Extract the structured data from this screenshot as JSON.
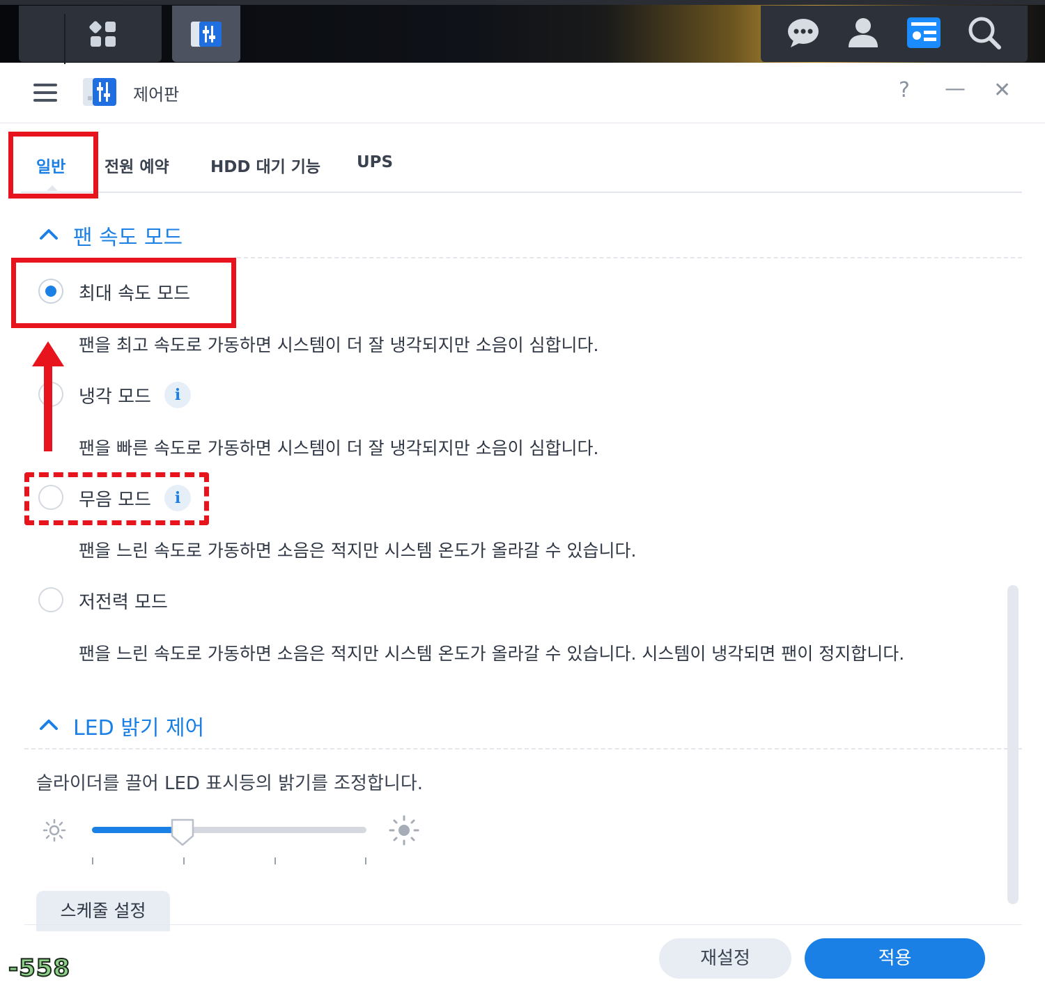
{
  "taskbar": {
    "left_icons": [
      "main-menu-icon",
      "control-panel-app-icon"
    ],
    "right_icons": [
      "chat-icon",
      "user-icon",
      "widgets-icon",
      "search-icon"
    ]
  },
  "window": {
    "title": "제어판",
    "help_label": "?",
    "minimize_label": "—",
    "close_label": "✕"
  },
  "tabs": [
    {
      "label": "일반",
      "active": true
    },
    {
      "label": "전원 예약",
      "active": false
    },
    {
      "label": "HDD 대기 기능",
      "active": false
    },
    {
      "label": "UPS",
      "active": false
    }
  ],
  "fan_section": {
    "title": "팬 속도 모드",
    "options": [
      {
        "label": "최대 속도 모드",
        "checked": true,
        "info": false,
        "description": "팬을 최고 속도로 가동하면 시스템이 더 잘 냉각되지만 소음이 심합니다."
      },
      {
        "label": "냉각 모드",
        "checked": false,
        "info": true,
        "description": "팬을 빠른 속도로 가동하면 시스템이 더 잘 냉각되지만 소음이 심합니다."
      },
      {
        "label": "무음 모드",
        "checked": false,
        "info": true,
        "description": "팬을 느린 속도로 가동하면 소음은 적지만 시스템 온도가 올라갈 수 있습니다."
      },
      {
        "label": "저전력 모드",
        "checked": false,
        "info": false,
        "description": "팬을 느린 속도로 가동하면 소음은 적지만 시스템 온도가 올라갈 수 있습니다. 시스템이 냉각되면 팬이 정지합니다."
      }
    ]
  },
  "led_section": {
    "title": "LED 밝기 제어",
    "description": "슬라이더를 끌어 LED 표시등의 밝기를 조정합니다.",
    "slider_level": 0.33,
    "slider_steps": 4,
    "schedule_button": "스케줄 설정"
  },
  "footer": {
    "reset_label": "재설정",
    "apply_label": "적용"
  },
  "info_glyph": "i",
  "watermark": "-558",
  "colors": {
    "accent": "#1a80e6",
    "annotation_red": "#e8141d"
  }
}
